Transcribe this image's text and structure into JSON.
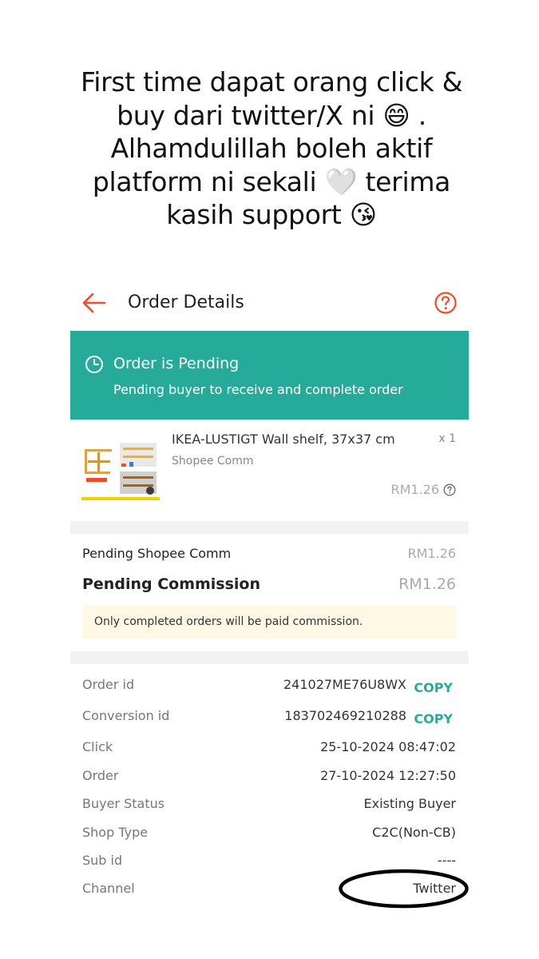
{
  "caption": {
    "lines": [
      "First time dapat orang click &",
      "buy dari twitter/X ni 😄 .",
      "Alhamdulillah boleh aktif",
      "platform ni sekali 🤍 terima",
      "kasih support 😘"
    ]
  },
  "header": {
    "title": "Order Details",
    "back_icon": "arrow-left-icon",
    "help_icon": "question-circle-icon"
  },
  "status": {
    "icon": "clock-icon",
    "title": "Order is Pending",
    "subtitle": "Pending buyer to receive and complete order"
  },
  "product": {
    "name": "IKEA-LUSTIGT Wall shelf, 37x37 cm",
    "quantity": "x 1",
    "source": "Shopee Comm",
    "price": "RM1.26"
  },
  "commission": {
    "shopee_label": "Pending Shopee Comm",
    "shopee_value": "RM1.26",
    "total_label": "Pending Commission",
    "total_value": "RM1.26",
    "note": "Only completed orders will be paid commission."
  },
  "details": [
    {
      "label": "Order id",
      "value": "241027ME76U8WX",
      "copy": "COPY"
    },
    {
      "label": "Conversion id",
      "value": "183702469210288",
      "copy": "COPY"
    },
    {
      "label": "Click",
      "value": "25-10-2024 08:47:02"
    },
    {
      "label": "Order",
      "value": "27-10-2024 12:27:50"
    },
    {
      "label": "Buyer Status",
      "value": "Existing Buyer"
    },
    {
      "label": "Shop Type",
      "value": "C2C(Non-CB)"
    },
    {
      "label": "Sub id",
      "value": "----"
    },
    {
      "label": "Channel",
      "value": "Twitter"
    }
  ],
  "colors": {
    "accent": "#ee4d2d",
    "teal": "#26aa99",
    "note_bg": "#fff8e4"
  }
}
